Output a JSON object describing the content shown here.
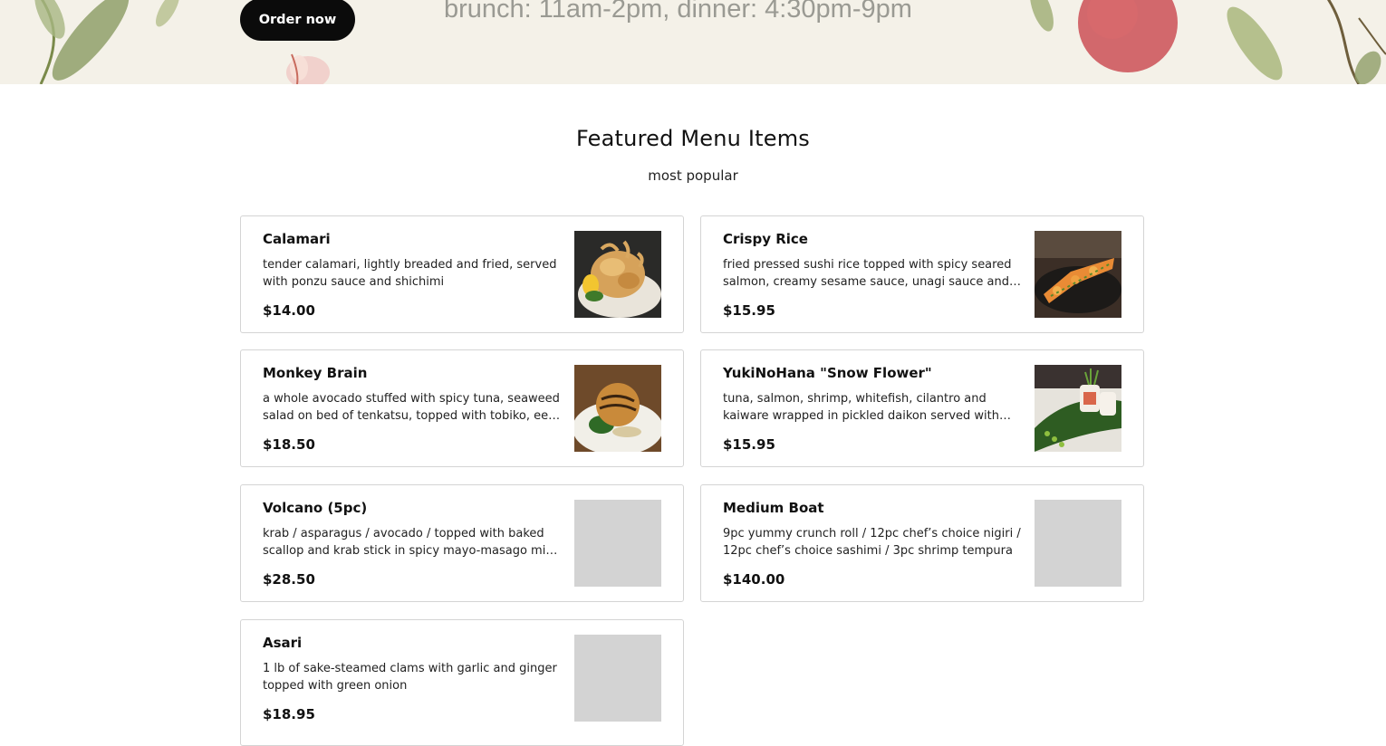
{
  "hero": {
    "order_button": "Order now",
    "hours_text": "brunch: 11am-2pm, dinner: 4:30pm-9pm"
  },
  "featured": {
    "title": "Featured Menu Items",
    "subtitle": "most popular"
  },
  "menu_items": [
    {
      "name": "Calamari",
      "description": "tender calamari, lightly breaded and fried, served with ponzu sauce and shichimi",
      "price": "$14.00",
      "image": "calamari-photo"
    },
    {
      "name": "Crispy Rice",
      "description": "fried pressed sushi rice topped with spicy seared salmon, creamy sesame sauce, unagi sauce and scallions",
      "price": "$15.95",
      "image": "crispy-rice-photo"
    },
    {
      "name": "Monkey Brain",
      "description": "a whole avocado stuffed with spicy tuna, seaweed salad on bed of tenkatsu, topped with tobiko, eel sauce and spicy mayo",
      "price": "$18.50",
      "image": "monkey-brain-photo"
    },
    {
      "name": "YukiNoHana \"Snow Flower\"",
      "description": "tuna, salmon, shrimp, whitefish, cilantro and kaiware wrapped in pickled daikon served with wasabi sauce",
      "price": "$15.95",
      "image": "snow-flower-photo"
    },
    {
      "name": "Volcano (5pc)",
      "description": "krab / asparagus / avocado / topped with baked scallop and krab stick in spicy mayo-masago mix, eel sauce",
      "price": "$28.50",
      "image": "placeholder"
    },
    {
      "name": "Medium Boat",
      "description": "9pc yummy crunch roll / 12pc chef’s choice nigiri / 12pc chef’s choice sashimi / 3pc shrimp tempura",
      "price": "$140.00",
      "image": "placeholder"
    },
    {
      "name": "Asari",
      "description": "1 lb of sake-steamed clams with garlic and ginger topped with green onion",
      "price": "$18.95",
      "image": "placeholder"
    }
  ]
}
